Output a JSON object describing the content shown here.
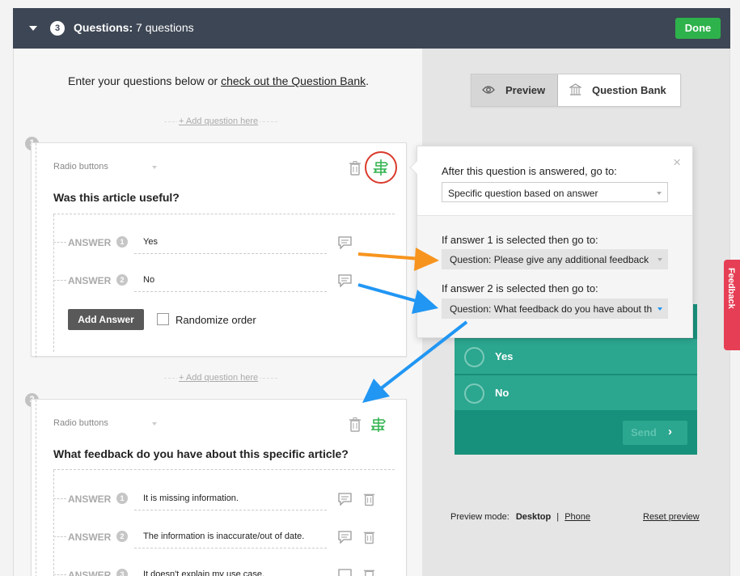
{
  "header": {
    "step_number": "3",
    "title_bold": "Questions:",
    "title_rest": "7 questions",
    "done_label": "Done"
  },
  "intro": {
    "text": "Enter your questions below or ",
    "link": "check out the Question Bank",
    "suffix": "."
  },
  "add_question_label": "+ Add question here",
  "questions": [
    {
      "number": "1",
      "type": "Radio buttons",
      "title": "Was this article useful?",
      "answers": [
        {
          "label": "ANSWER",
          "number": "1",
          "value": "Yes"
        },
        {
          "label": "ANSWER",
          "number": "2",
          "value": "No"
        }
      ],
      "add_answer_label": "Add Answer",
      "randomize_label": "Randomize order"
    },
    {
      "number": "2",
      "type": "Radio buttons",
      "title": "What feedback do you have about this specific article?",
      "answers": [
        {
          "label": "ANSWER",
          "number": "1",
          "value": "It is missing information."
        },
        {
          "label": "ANSWER",
          "number": "2",
          "value": "The information is inaccurate/out of date."
        },
        {
          "label": "ANSWER",
          "number": "3",
          "value": "It doesn't explain my use case."
        }
      ]
    }
  ],
  "preview_tabs": {
    "preview": "Preview",
    "question_bank": "Question Bank"
  },
  "logic_popup": {
    "heading": "After this question is answered, go to:",
    "main_select": "Specific question based on answer",
    "rule1_label": "If answer 1 is selected then go to:",
    "rule1_value": "Question: Please give any additional feedback",
    "rule2_label": "If answer 2 is selected then go to:",
    "rule2_value": "Question: What feedback do you have about this specific article?",
    "close": "×"
  },
  "widget": {
    "options": [
      "Yes",
      "No"
    ],
    "send_label": "Send",
    "colors": {
      "bg": "#17917b",
      "option": "#2ba68f"
    }
  },
  "preview_footer": {
    "mode_label": "Preview mode:",
    "desktop": "Desktop",
    "separator": "|",
    "phone": "Phone",
    "reset": "Reset preview"
  },
  "feedback_tab": "Feedback",
  "colors": {
    "header_bg": "#3d4654",
    "done_green": "#2eb24b",
    "orange_arrow": "#f7941d",
    "blue_arrow": "#2196f3",
    "highlight_circle": "#d93a2b",
    "feedback_red": "#e63f55"
  }
}
